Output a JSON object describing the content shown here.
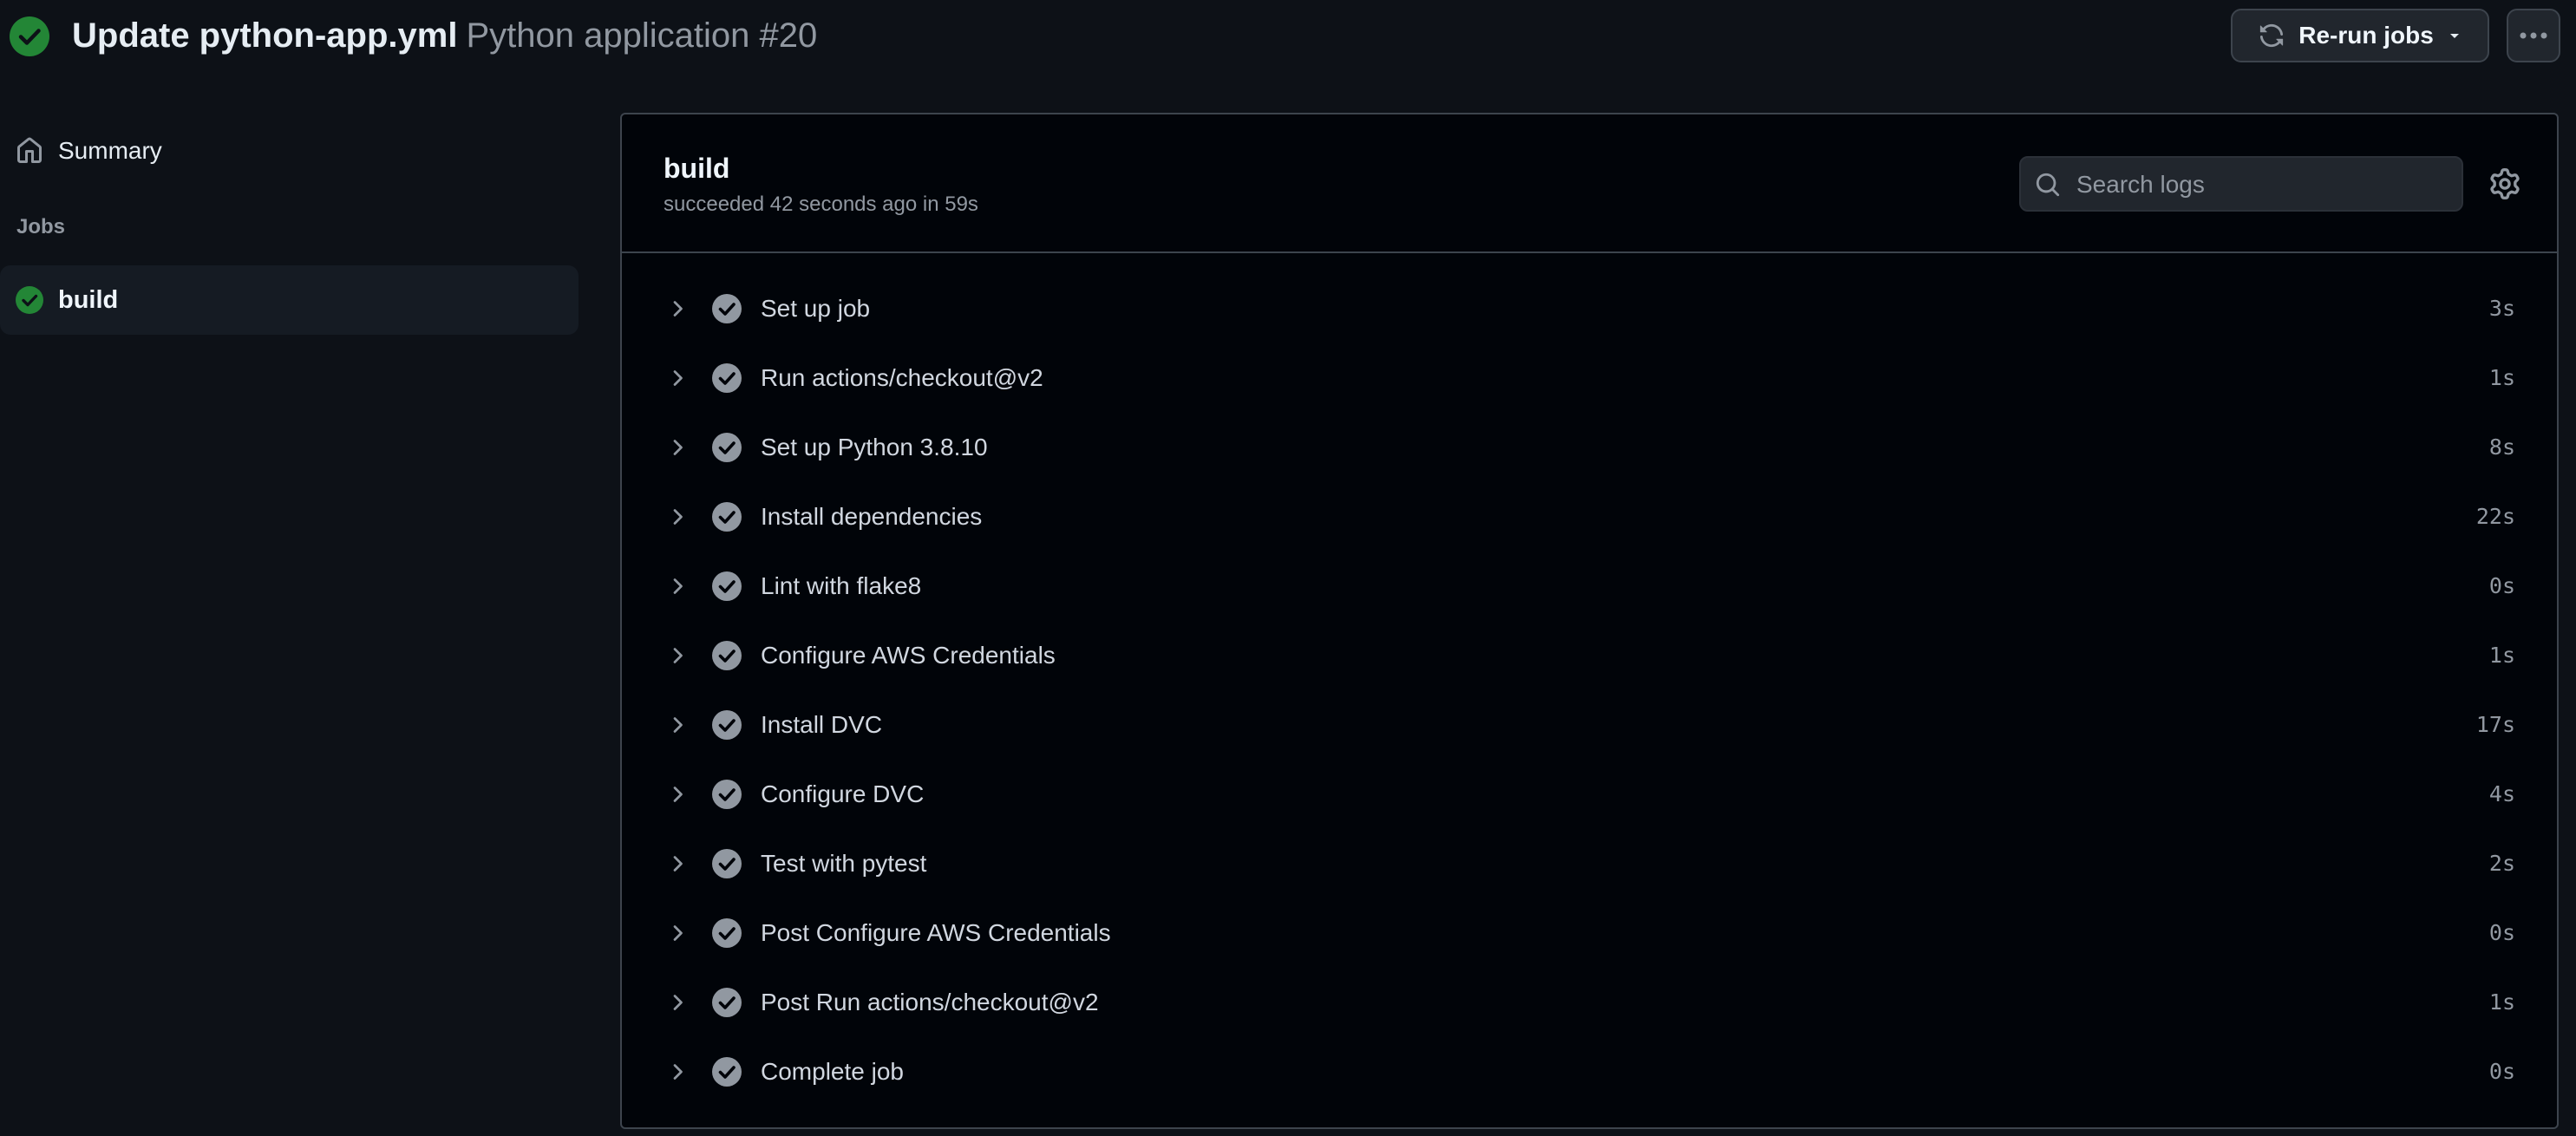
{
  "header": {
    "title": "Update python-app.yml",
    "subtitle": "Python application #20",
    "rerun_label": "Re-run jobs",
    "colors": {
      "success": "#238636",
      "background": "#0d1117"
    }
  },
  "sidebar": {
    "summary_label": "Summary",
    "jobs_heading": "Jobs",
    "jobs": [
      {
        "label": "build",
        "status": "success"
      }
    ]
  },
  "panel": {
    "title": "build",
    "status_text": "succeeded 42 seconds ago in 59s",
    "search": {
      "placeholder": "Search logs",
      "value": ""
    }
  },
  "steps": [
    {
      "name": "Set up job",
      "duration": "3s"
    },
    {
      "name": "Run actions/checkout@v2",
      "duration": "1s"
    },
    {
      "name": "Set up Python 3.8.10",
      "duration": "8s"
    },
    {
      "name": "Install dependencies",
      "duration": "22s"
    },
    {
      "name": "Lint with flake8",
      "duration": "0s"
    },
    {
      "name": "Configure AWS Credentials",
      "duration": "1s"
    },
    {
      "name": "Install DVC",
      "duration": "17s"
    },
    {
      "name": "Configure DVC",
      "duration": "4s"
    },
    {
      "name": "Test with pytest",
      "duration": "2s"
    },
    {
      "name": "Post Configure AWS Credentials",
      "duration": "0s"
    },
    {
      "name": "Post Run actions/checkout@v2",
      "duration": "1s"
    },
    {
      "name": "Complete job",
      "duration": "0s"
    }
  ]
}
